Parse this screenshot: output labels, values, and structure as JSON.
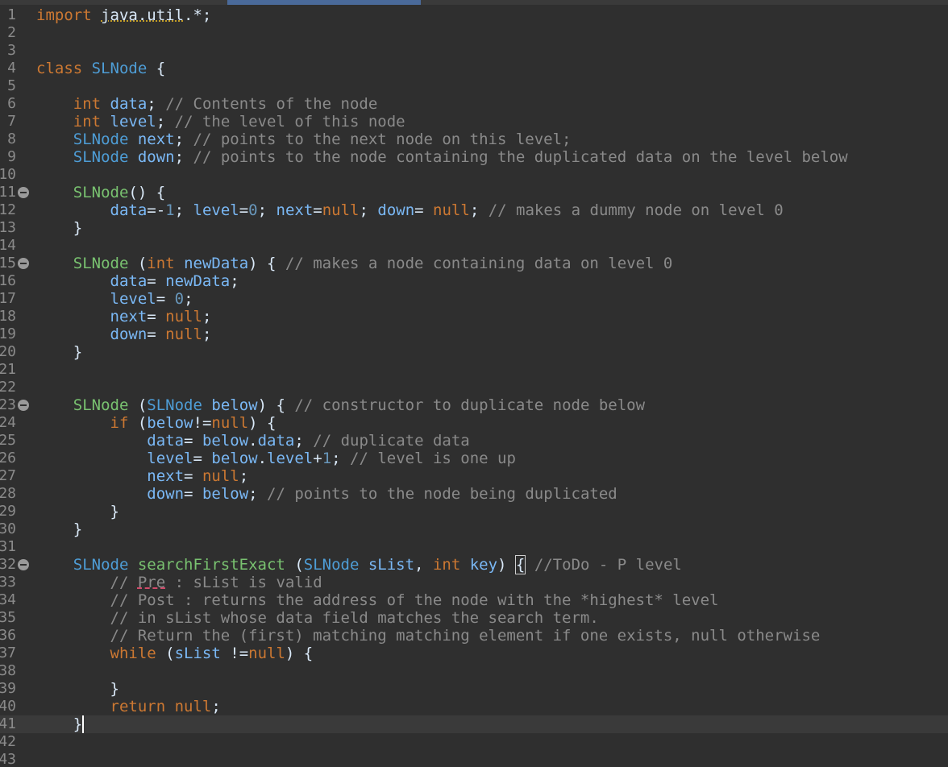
{
  "editor": {
    "language": "java",
    "current_line": 41,
    "lines": [
      {
        "n": "1",
        "fold": false,
        "tokens": [
          [
            "kw",
            "import "
          ],
          [
            "tx",
            ""
          ],
          [
            "tx",
            ""
          ],
          [
            "warn",
            "java.util"
          ],
          [
            "tx",
            ".*;"
          ]
        ]
      },
      {
        "n": "2",
        "fold": false,
        "tokens": []
      },
      {
        "n": "3",
        "fold": false,
        "tokens": []
      },
      {
        "n": "4",
        "fold": false,
        "tokens": [
          [
            "kw",
            "class "
          ],
          [
            "ty",
            "SLNode"
          ],
          [
            "tx",
            " {"
          ]
        ]
      },
      {
        "n": "5",
        "fold": false,
        "tokens": []
      },
      {
        "n": "6",
        "fold": false,
        "tokens": [
          [
            "tx",
            "    "
          ],
          [
            "kw",
            "int "
          ],
          [
            "va",
            "data"
          ],
          [
            "tx",
            "; "
          ],
          [
            "cm",
            "// Contents of the node"
          ]
        ]
      },
      {
        "n": "7",
        "fold": false,
        "tokens": [
          [
            "tx",
            "    "
          ],
          [
            "kw",
            "int "
          ],
          [
            "va",
            "level"
          ],
          [
            "tx",
            "; "
          ],
          [
            "cm",
            "// the level of this node"
          ]
        ]
      },
      {
        "n": "8",
        "fold": false,
        "tokens": [
          [
            "tx",
            "    "
          ],
          [
            "ty",
            "SLNode "
          ],
          [
            "va",
            "next"
          ],
          [
            "tx",
            "; "
          ],
          [
            "cm",
            "// points to the next node on this level;"
          ]
        ]
      },
      {
        "n": "9",
        "fold": false,
        "tokens": [
          [
            "tx",
            "    "
          ],
          [
            "ty",
            "SLNode "
          ],
          [
            "va",
            "down"
          ],
          [
            "tx",
            "; "
          ],
          [
            "cm",
            "// points to the node containing the duplicated data on the level below"
          ]
        ]
      },
      {
        "n": "10",
        "fold": false,
        "tokens": []
      },
      {
        "n": "11",
        "fold": true,
        "tokens": [
          [
            "tx",
            "    "
          ],
          [
            "fn",
            "SLNode"
          ],
          [
            "tx",
            "() {"
          ]
        ]
      },
      {
        "n": "12",
        "fold": false,
        "tokens": [
          [
            "tx",
            "        "
          ],
          [
            "va",
            "data"
          ],
          [
            "tx",
            "=-"
          ],
          [
            "nu",
            "1"
          ],
          [
            "tx",
            "; "
          ],
          [
            "va",
            "level"
          ],
          [
            "tx",
            "="
          ],
          [
            "nu",
            "0"
          ],
          [
            "tx",
            "; "
          ],
          [
            "va",
            "next"
          ],
          [
            "tx",
            "="
          ],
          [
            "kw",
            "null"
          ],
          [
            "tx",
            "; "
          ],
          [
            "va",
            "down"
          ],
          [
            "tx",
            "= "
          ],
          [
            "kw",
            "null"
          ],
          [
            "tx",
            "; "
          ],
          [
            "cm",
            "// makes a dummy node on level 0"
          ]
        ]
      },
      {
        "n": "13",
        "fold": false,
        "tokens": [
          [
            "tx",
            "    }"
          ]
        ]
      },
      {
        "n": "14",
        "fold": false,
        "tokens": []
      },
      {
        "n": "15",
        "fold": true,
        "tokens": [
          [
            "tx",
            "    "
          ],
          [
            "fn",
            "SLNode"
          ],
          [
            "tx",
            " ("
          ],
          [
            "kw",
            "int "
          ],
          [
            "va",
            "newData"
          ],
          [
            "tx",
            ") { "
          ],
          [
            "cm",
            "// makes a node containing data on level 0"
          ]
        ]
      },
      {
        "n": "16",
        "fold": false,
        "tokens": [
          [
            "tx",
            "        "
          ],
          [
            "va",
            "data"
          ],
          [
            "tx",
            "= "
          ],
          [
            "va",
            "newData"
          ],
          [
            "tx",
            ";"
          ]
        ]
      },
      {
        "n": "17",
        "fold": false,
        "tokens": [
          [
            "tx",
            "        "
          ],
          [
            "va",
            "level"
          ],
          [
            "tx",
            "= "
          ],
          [
            "nu",
            "0"
          ],
          [
            "tx",
            ";"
          ]
        ]
      },
      {
        "n": "18",
        "fold": false,
        "tokens": [
          [
            "tx",
            "        "
          ],
          [
            "va",
            "next"
          ],
          [
            "tx",
            "= "
          ],
          [
            "kw",
            "null"
          ],
          [
            "tx",
            ";"
          ]
        ]
      },
      {
        "n": "19",
        "fold": false,
        "tokens": [
          [
            "tx",
            "        "
          ],
          [
            "va",
            "down"
          ],
          [
            "tx",
            "= "
          ],
          [
            "kw",
            "null"
          ],
          [
            "tx",
            ";"
          ]
        ]
      },
      {
        "n": "20",
        "fold": false,
        "tokens": [
          [
            "tx",
            "    }"
          ]
        ]
      },
      {
        "n": "21",
        "fold": false,
        "tokens": []
      },
      {
        "n": "22",
        "fold": false,
        "tokens": []
      },
      {
        "n": "23",
        "fold": true,
        "tokens": [
          [
            "tx",
            "    "
          ],
          [
            "fn",
            "SLNode"
          ],
          [
            "tx",
            " ("
          ],
          [
            "ty",
            "SLNode "
          ],
          [
            "va",
            "below"
          ],
          [
            "tx",
            ") { "
          ],
          [
            "cm",
            "// constructor to duplicate node below"
          ]
        ]
      },
      {
        "n": "24",
        "fold": false,
        "tokens": [
          [
            "tx",
            "        "
          ],
          [
            "kw",
            "if"
          ],
          [
            "tx",
            " ("
          ],
          [
            "va",
            "below"
          ],
          [
            "tx",
            "!="
          ],
          [
            "kw",
            "null"
          ],
          [
            "tx",
            ") {"
          ]
        ]
      },
      {
        "n": "25",
        "fold": false,
        "tokens": [
          [
            "tx",
            "            "
          ],
          [
            "va",
            "data"
          ],
          [
            "tx",
            "= "
          ],
          [
            "va",
            "below"
          ],
          [
            "tx",
            "."
          ],
          [
            "va",
            "data"
          ],
          [
            "tx",
            "; "
          ],
          [
            "cm",
            "// duplicate data"
          ]
        ]
      },
      {
        "n": "26",
        "fold": false,
        "tokens": [
          [
            "tx",
            "            "
          ],
          [
            "va",
            "level"
          ],
          [
            "tx",
            "= "
          ],
          [
            "va",
            "below"
          ],
          [
            "tx",
            "."
          ],
          [
            "va",
            "level"
          ],
          [
            "tx",
            "+"
          ],
          [
            "nu",
            "1"
          ],
          [
            "tx",
            "; "
          ],
          [
            "cm",
            "// level is one up"
          ]
        ]
      },
      {
        "n": "27",
        "fold": false,
        "tokens": [
          [
            "tx",
            "            "
          ],
          [
            "va",
            "next"
          ],
          [
            "tx",
            "= "
          ],
          [
            "kw",
            "null"
          ],
          [
            "tx",
            ";"
          ]
        ]
      },
      {
        "n": "28",
        "fold": false,
        "tokens": [
          [
            "tx",
            "            "
          ],
          [
            "va",
            "down"
          ],
          [
            "tx",
            "= "
          ],
          [
            "va",
            "below"
          ],
          [
            "tx",
            "; "
          ],
          [
            "cm",
            "// points to the node being duplicated"
          ]
        ]
      },
      {
        "n": "29",
        "fold": false,
        "tokens": [
          [
            "tx",
            "        }"
          ]
        ]
      },
      {
        "n": "30",
        "fold": false,
        "tokens": [
          [
            "tx",
            "    }"
          ]
        ]
      },
      {
        "n": "31",
        "fold": false,
        "tokens": []
      },
      {
        "n": "32",
        "fold": true,
        "tokens": [
          [
            "tx",
            "    "
          ],
          [
            "ty",
            "SLNode "
          ],
          [
            "fn",
            "searchFirstExact"
          ],
          [
            "tx",
            " ("
          ],
          [
            "ty",
            "SLNode "
          ],
          [
            "va",
            "sList"
          ],
          [
            "tx",
            ", "
          ],
          [
            "kw",
            "int "
          ],
          [
            "va",
            "key"
          ],
          [
            "tx",
            ") "
          ],
          [
            "bracket",
            "{"
          ],
          [
            "tx",
            " "
          ],
          [
            "cm",
            "//ToDo - P level"
          ]
        ]
      },
      {
        "n": "33",
        "fold": false,
        "tokens": [
          [
            "tx",
            "        "
          ],
          [
            "cm",
            "// "
          ],
          [
            "err",
            "Pre"
          ],
          [
            "cm",
            " : sList is valid"
          ]
        ]
      },
      {
        "n": "34",
        "fold": false,
        "tokens": [
          [
            "tx",
            "        "
          ],
          [
            "cm",
            "// Post : returns the address of the node with the *highest* level"
          ]
        ]
      },
      {
        "n": "35",
        "fold": false,
        "tokens": [
          [
            "tx",
            "        "
          ],
          [
            "cm",
            "// in sList whose data field matches the search term."
          ]
        ]
      },
      {
        "n": "36",
        "fold": false,
        "tokens": [
          [
            "tx",
            "        "
          ],
          [
            "cm",
            "// Return the (first) matching matching element if one exists, null otherwise"
          ]
        ]
      },
      {
        "n": "37",
        "fold": false,
        "tokens": [
          [
            "tx",
            "        "
          ],
          [
            "kw",
            "while"
          ],
          [
            "tx",
            " ("
          ],
          [
            "va",
            "sList"
          ],
          [
            "tx",
            " !="
          ],
          [
            "kw",
            "null"
          ],
          [
            "tx",
            ") {"
          ]
        ]
      },
      {
        "n": "38",
        "fold": false,
        "tokens": []
      },
      {
        "n": "39",
        "fold": false,
        "tokens": [
          [
            "tx",
            "        }"
          ]
        ]
      },
      {
        "n": "40",
        "fold": false,
        "tokens": [
          [
            "tx",
            "        "
          ],
          [
            "kw",
            "return null"
          ],
          [
            "tx",
            ";"
          ]
        ]
      },
      {
        "n": "41",
        "fold": false,
        "tokens": [
          [
            "tx",
            "    "
          ],
          [
            "caret",
            "}"
          ]
        ]
      },
      {
        "n": "42",
        "fold": false,
        "tokens": []
      },
      {
        "n": "43",
        "fold": false,
        "tokens": []
      }
    ]
  }
}
